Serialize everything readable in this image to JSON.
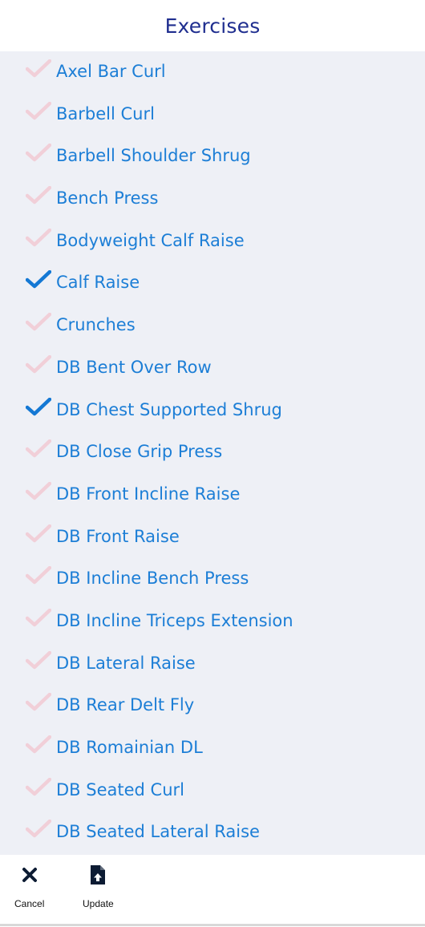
{
  "header": {
    "title": "Exercises"
  },
  "colors": {
    "title": "#1f2e8f",
    "item_text": "#1c7ed6",
    "check_selected": "#1478d4",
    "check_unselected": "#f1cfd8",
    "list_background": "#eef0f6"
  },
  "exercises": [
    {
      "label": "Axel Bar Curl",
      "selected": false
    },
    {
      "label": "Barbell Curl",
      "selected": false
    },
    {
      "label": "Barbell Shoulder Shrug",
      "selected": false
    },
    {
      "label": "Bench Press",
      "selected": false
    },
    {
      "label": "Bodyweight Calf Raise",
      "selected": false
    },
    {
      "label": "Calf Raise",
      "selected": true
    },
    {
      "label": "Crunches",
      "selected": false
    },
    {
      "label": "DB Bent Over Row",
      "selected": false
    },
    {
      "label": "DB Chest Supported Shrug",
      "selected": true
    },
    {
      "label": "DB Close Grip Press",
      "selected": false
    },
    {
      "label": "DB Front Incline Raise",
      "selected": false
    },
    {
      "label": "DB Front Raise",
      "selected": false
    },
    {
      "label": "DB Incline Bench Press",
      "selected": false
    },
    {
      "label": "DB Incline Triceps Extension",
      "selected": false
    },
    {
      "label": "DB Lateral Raise",
      "selected": false
    },
    {
      "label": "DB Rear Delt Fly",
      "selected": false
    },
    {
      "label": "DB Romainian DL",
      "selected": false
    },
    {
      "label": "DB Seated Curl",
      "selected": false
    },
    {
      "label": "DB Seated Lateral Raise",
      "selected": false
    }
  ],
  "toolbar": {
    "cancel_label": "Cancel",
    "cancel_icon": "close-icon",
    "update_label": "Update",
    "update_icon": "file-upload-icon"
  }
}
